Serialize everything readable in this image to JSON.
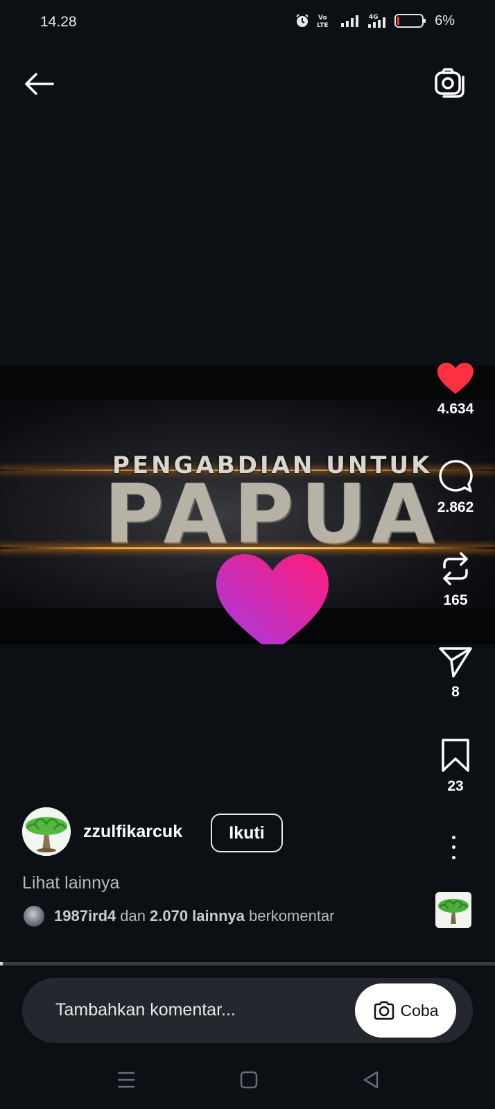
{
  "status_bar": {
    "time": "14.28",
    "battery_percent": "6%",
    "battery_level": 0.06,
    "icons": [
      "alarm-icon",
      "volte-icon",
      "signal-icon",
      "4g-signal-icon",
      "battery-icon"
    ]
  },
  "header": {
    "back_icon": "arrow-left-icon",
    "camera_icon": "camera-icon"
  },
  "video": {
    "subtitle": "PENGABDIAN UNTUK",
    "title": "PAPUA",
    "overlay_icon": "heart-icon",
    "colors": {
      "flare": "#ff9a1f",
      "heart_start": "#b12ee0",
      "heart_end": "#ff1c7a"
    }
  },
  "actions": {
    "like": {
      "icon": "heart-icon",
      "count": "4.634",
      "active": true,
      "color": "#ff3040"
    },
    "comment": {
      "icon": "comment-icon",
      "count": "2.862"
    },
    "repost": {
      "icon": "repost-icon",
      "count": "165"
    },
    "share": {
      "icon": "send-icon",
      "count": "8"
    },
    "save": {
      "icon": "bookmark-icon",
      "count": "23"
    },
    "more": {
      "icon": "more-vertical-icon"
    }
  },
  "author": {
    "username": "zzulfikarcuk",
    "follow_label": "Ikuti"
  },
  "caption": {
    "see_more": "Lihat lainnya"
  },
  "comments_summary": {
    "user": "1987ird4",
    "connector": "dan",
    "others": "2.070 lainnya",
    "suffix": "berkomentar"
  },
  "progress": {
    "fraction": 0.006
  },
  "comment_bar": {
    "placeholder": "Tambahkan komentar...",
    "try_label": "Coba",
    "try_icon": "camera-icon"
  },
  "nav": {
    "icons": [
      "menu-icon",
      "home-square-icon",
      "back-triangle-icon"
    ]
  }
}
